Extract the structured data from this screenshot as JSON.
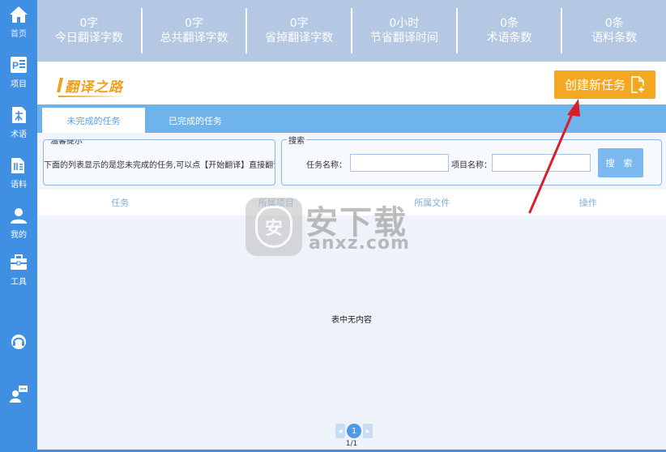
{
  "sidebar": {
    "items": [
      {
        "label": "首页",
        "icon": "home-icon"
      },
      {
        "label": "项目",
        "icon": "project-icon"
      },
      {
        "label": "术语",
        "icon": "term-icon"
      },
      {
        "label": "语料",
        "icon": "corpus-icon"
      },
      {
        "label": "我的",
        "icon": "user-icon"
      },
      {
        "label": "工具",
        "icon": "toolbox-icon"
      }
    ],
    "extra_icons": [
      "headset-icon",
      "chat-user-icon"
    ]
  },
  "stats": [
    {
      "value": "0字",
      "label": "今日翻译字数"
    },
    {
      "value": "0字",
      "label": "总共翻译字数"
    },
    {
      "value": "0字",
      "label": "省掉翻译字数"
    },
    {
      "value": "0小时",
      "label": "节省翻译时间"
    },
    {
      "value": "0条",
      "label": "术语条数"
    },
    {
      "value": "0条",
      "label": "语料条数"
    }
  ],
  "logo": {
    "text": "翻译之路"
  },
  "create_button": {
    "label": "创建新任务"
  },
  "tabs": [
    {
      "label": "未完成的任务",
      "active": true
    },
    {
      "label": "已完成的任务",
      "active": false
    }
  ],
  "tip": {
    "legend": "温馨提示",
    "text": "下面的列表显示的是您未完成的任务,可以点【开始翻译】直接翻译"
  },
  "search": {
    "legend": "搜索",
    "task_name_label": "任务名称：",
    "task_name_value": "",
    "project_name_label": "项目名称：",
    "project_name_value": "",
    "button_label": "搜 索"
  },
  "table": {
    "columns": [
      "任务",
      "所属项目",
      "所属文件",
      "操作"
    ],
    "empty_text": "表中无内容"
  },
  "pagination": {
    "prev": "◂",
    "current": "1",
    "next": "▸",
    "info": "1/1"
  },
  "watermark": {
    "badge": "安",
    "cn": "安下载",
    "en": "anxz.com"
  },
  "colors": {
    "sidebar": "#3f8fe2",
    "stats_bar": "#b4c8e3",
    "accent_orange": "#f4a822",
    "tab_bar": "#6fb3ec",
    "arrow": "#d8202a"
  }
}
